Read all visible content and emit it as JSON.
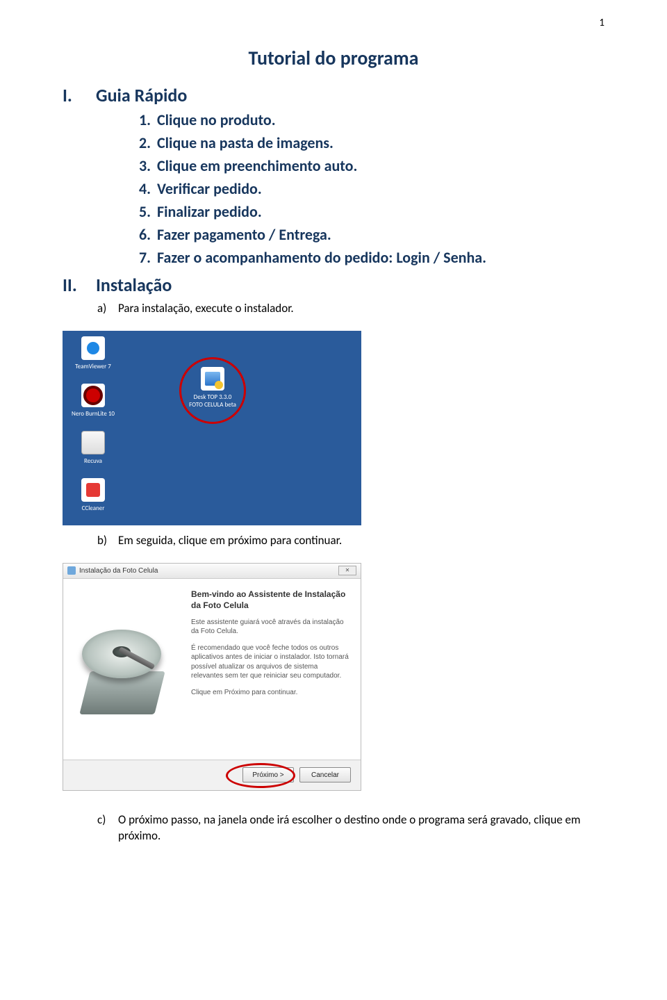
{
  "page_number": "1",
  "title": "Tutorial do programa",
  "sections": {
    "I": {
      "roman": "I.",
      "label": "Guia Rápido",
      "items": [
        {
          "n": "1.",
          "text": "Clique no produto."
        },
        {
          "n": "2.",
          "text": "Clique na pasta de imagens."
        },
        {
          "n": "3.",
          "text": "Clique em preenchimento auto."
        },
        {
          "n": "4.",
          "text": "Verificar pedido."
        },
        {
          "n": "5.",
          "text": "Finalizar pedido."
        },
        {
          "n": "6.",
          "text": "Fazer pagamento / Entrega."
        },
        {
          "n": "7.",
          "text": "Fazer o acompanhamento do pedido: Login / Senha."
        }
      ]
    },
    "II": {
      "roman": "II.",
      "label": "Instalação",
      "items": [
        {
          "a": "a)",
          "text": "Para instalação, execute o instalador."
        },
        {
          "a": "b)",
          "text": "Em seguida, clique em próximo para continuar."
        },
        {
          "a": "c)",
          "text": "O próximo passo, na janela onde irá escolher o destino onde o programa será gravado, clique em próximo."
        }
      ]
    }
  },
  "desktop": {
    "icons": {
      "teamviewer": "TeamViewer 7",
      "nero": "Nero BurnLite 10",
      "recuva": "Recuva",
      "ccleaner": "CCleaner",
      "installer_line1": "Desk TOP 3.3.0",
      "installer_line2": "FOTO CELULA beta"
    }
  },
  "installer": {
    "title": "Instalação da Foto Celula",
    "heading": "Bem-vindo ao Assistente de Instalação da Foto Celula",
    "p1": "Este assistente guiará você através da instalação da Foto Celula.",
    "p2": "É recomendado que você feche todos os outros aplicativos antes de iniciar o instalador. Isto tornará possível atualizar os arquivos de sistema relevantes sem ter que reiniciar seu computador.",
    "p3": "Clique em Próximo para continuar.",
    "btn_next": "Próximo >",
    "btn_cancel": "Cancelar",
    "win_close": "✕"
  }
}
